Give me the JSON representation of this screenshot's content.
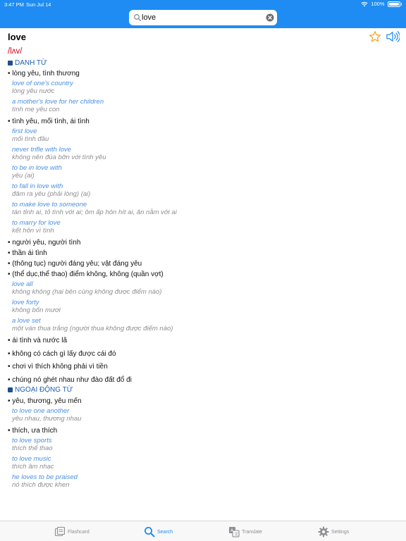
{
  "status": {
    "time": "3:47 PM",
    "date": "Sun Jul 14",
    "battery": "100%"
  },
  "search": {
    "value": "love",
    "placeholder": ""
  },
  "entry": {
    "word": "love",
    "pronunciation": "/lʌv/",
    "noun_label": "DANH TỪ",
    "verb_label": "NGOẠI ĐỘNG TỪ",
    "noun_senses": [
      {
        "text": "• lòng yêu, tình thương",
        "examples": [
          {
            "en": "love of one's country",
            "vi": "lòng yêu nước"
          },
          {
            "en": "a mother's love for her children",
            "vi": "tình mẹ yêu con"
          }
        ]
      },
      {
        "text": "• tình yêu, mối tình, ái tình",
        "examples": [
          {
            "en": "first love",
            "vi": "mối tình đầu"
          },
          {
            "en": "never trifle with love",
            "vi": "không nên đùa bỡn với tình yêu"
          },
          {
            "en": "to be in love with",
            "vi": "yêu (ai)"
          },
          {
            "en": "to fall in love with",
            "vi": "đâm ra yêu (phải lòng) (ai)"
          },
          {
            "en": "to make love to someone",
            "vi": "tán tỉnh ai, tỏ tình với ai; ôm ấp hôn hít ai, ăn nằm với ai"
          },
          {
            "en": "to marry for love",
            "vi": "kết hôn vì tình"
          }
        ]
      },
      {
        "text": "• người yêu, người tình",
        "examples": []
      },
      {
        "text": "• thần ái tình",
        "examples": []
      },
      {
        "text": "• (thông tục) người đáng yêu; vật đáng yêu",
        "examples": []
      },
      {
        "text": "• (thể dục,thể thao) điểm không, không (quần vợt)",
        "examples": [
          {
            "en": "love all",
            "vi": "không không (hai bên cùng không được điểm nào)"
          },
          {
            "en": "love forty",
            "vi": "không bốn mươi"
          },
          {
            "en": "a love set",
            "vi": "một ván thua trắng (người thua không được điểm nào)"
          }
        ]
      },
      {
        "text": "• ái tình và nước lã",
        "examples": []
      },
      {
        "text": "• không có cách gì lấy được cái đó",
        "examples": []
      },
      {
        "text": "• chơi vì thích không phải vì tiền",
        "examples": []
      },
      {
        "text": "• chúng nó ghét nhau như đào đất đổ đi",
        "examples": []
      }
    ],
    "verb_senses": [
      {
        "text": "• yêu, thương, yêu mến",
        "examples": [
          {
            "en": "to love one another",
            "vi": "yêu nhau, thương nhau"
          }
        ]
      },
      {
        "text": "• thích, ưa thích",
        "examples": [
          {
            "en": "to love sports",
            "vi": "thích thể thao"
          },
          {
            "en": "to love music",
            "vi": "thích âm nhạc"
          },
          {
            "en": "he loves to be praised",
            "vi": "nó thích được khen"
          }
        ]
      }
    ]
  },
  "tabs": {
    "flashcard": "Flashcard",
    "search": "Search",
    "translate": "Translate",
    "settings": "Settings"
  },
  "colors": {
    "accent": "#1e8cf3",
    "pronunciation": "#d0021b",
    "pos_label": "#1c5fae",
    "example_en": "#4a90e2",
    "example_vi": "#8e8e93",
    "star": "#f5a623"
  },
  "icons": [
    "search-icon",
    "clear-icon",
    "star-icon",
    "speaker-icon",
    "flashcard-icon",
    "search-tab-icon",
    "translate-icon",
    "gear-icon"
  ]
}
